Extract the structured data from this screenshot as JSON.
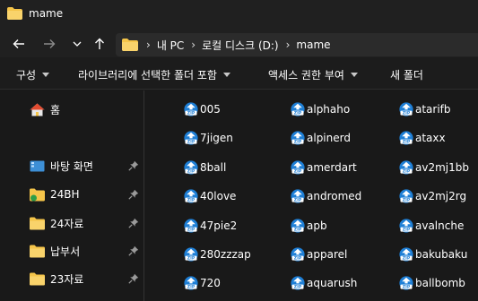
{
  "window": {
    "title": "mame"
  },
  "address": {
    "crumbs": [
      "내 PC",
      "로컬 디스크 (D:)",
      "mame"
    ],
    "separator": "›"
  },
  "toolbar": {
    "items": [
      "구성",
      "라이브러리에 선택한 폴더 포함",
      "액세스 권한 부여",
      "새 폴더"
    ]
  },
  "sidebar": {
    "items": [
      {
        "label": "홈",
        "icon": "home-icon",
        "pinned": false
      },
      {
        "label": "바탕 화면",
        "icon": "desktop-icon",
        "pinned": true
      },
      {
        "label": "24BH",
        "icon": "folder-icon",
        "pinned": true
      },
      {
        "label": "24자료",
        "icon": "folder-icon",
        "pinned": true
      },
      {
        "label": "납부서",
        "icon": "folder-icon",
        "pinned": true
      },
      {
        "label": "23자료",
        "icon": "folder-icon",
        "pinned": true
      }
    ]
  },
  "files": {
    "col1": [
      "005",
      "7jigen",
      "8ball",
      "40love",
      "47pie2",
      "280zzzap",
      "720"
    ],
    "col2": [
      "alphaho",
      "alpinerd",
      "amerdart",
      "andromed",
      "apb",
      "apparel",
      "aquarush"
    ],
    "col3": [
      "atarifb",
      "ataxx",
      "av2mj1bb",
      "av2mj2rg",
      "avalnche",
      "bakubaku",
      "ballbomb"
    ]
  },
  "colors": {
    "folder": "#f5c54a",
    "zip_blue": "#1e7fd6",
    "background": "#191919",
    "chrome": "#202020"
  }
}
